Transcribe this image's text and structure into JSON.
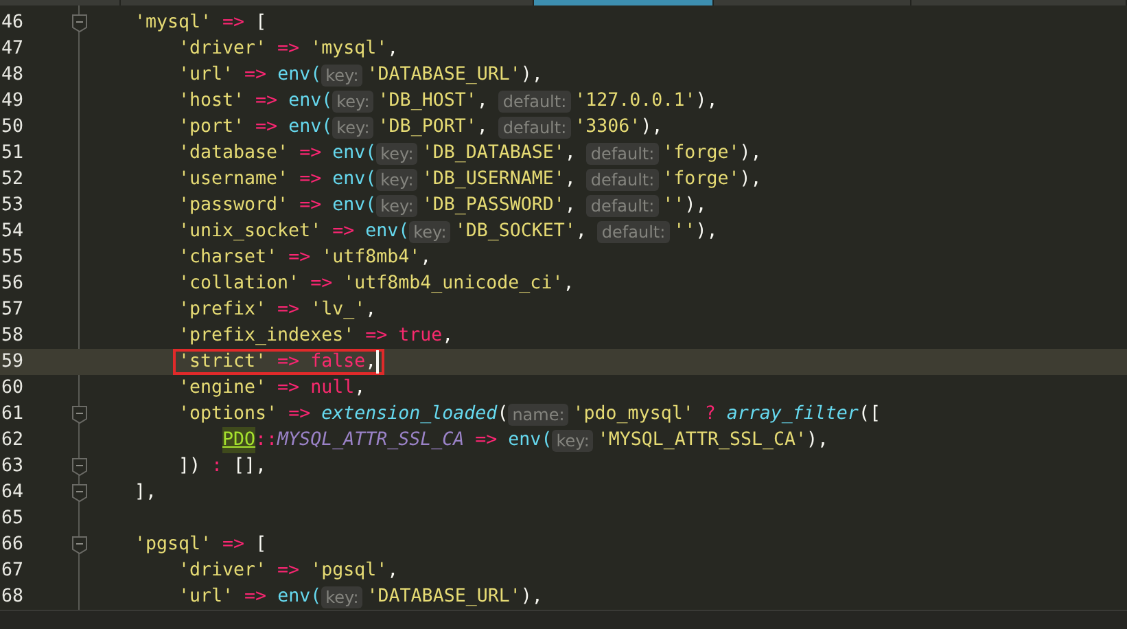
{
  "tabs": [
    {
      "selected": false
    },
    {
      "selected": false
    },
    {
      "selected": true
    },
    {
      "selected": false
    },
    {
      "selected": false
    }
  ],
  "lines": [
    {
      "number": "46",
      "fold": true,
      "current": false,
      "boxed": false,
      "caret": false,
      "tokens": [
        {
          "kind": "str",
          "text": "'mysql'"
        },
        {
          "kind": "op",
          "text": " => "
        },
        {
          "kind": "punc",
          "text": "["
        }
      ],
      "children": [
        {
          "number": "47",
          "fold": false,
          "current": false,
          "boxed": false,
          "caret": false,
          "tokens": [
            {
              "kind": "str",
              "text": "'driver'"
            },
            {
              "kind": "op",
              "text": " => "
            },
            {
              "kind": "str",
              "text": "'mysql'"
            },
            {
              "kind": "punc",
              "text": ","
            }
          ]
        },
        {
          "number": "48",
          "fold": false,
          "current": false,
          "boxed": false,
          "caret": false,
          "tokens": [
            {
              "kind": "str",
              "text": "'url'"
            },
            {
              "kind": "op",
              "text": " => "
            },
            {
              "kind": "func",
              "text": "env("
            },
            {
              "kind": "hint",
              "text": "key:"
            },
            {
              "kind": "str",
              "text": "'DATABASE_URL'"
            },
            {
              "kind": "punc",
              "text": "),"
            }
          ]
        },
        {
          "number": "49",
          "fold": false,
          "current": false,
          "boxed": false,
          "caret": false,
          "tokens": [
            {
              "kind": "str",
              "text": "'host'"
            },
            {
              "kind": "op",
              "text": " => "
            },
            {
              "kind": "func",
              "text": "env("
            },
            {
              "kind": "hint",
              "text": "key:"
            },
            {
              "kind": "str",
              "text": "'DB_HOST'"
            },
            {
              "kind": "punc",
              "text": ", "
            },
            {
              "kind": "hint",
              "text": "default:"
            },
            {
              "kind": "str",
              "text": "'127.0.0.1'"
            },
            {
              "kind": "punc",
              "text": "),"
            }
          ]
        },
        {
          "number": "50",
          "fold": false,
          "current": false,
          "boxed": false,
          "caret": false,
          "tokens": [
            {
              "kind": "str",
              "text": "'port'"
            },
            {
              "kind": "op",
              "text": " => "
            },
            {
              "kind": "func",
              "text": "env("
            },
            {
              "kind": "hint",
              "text": "key:"
            },
            {
              "kind": "str",
              "text": "'DB_PORT'"
            },
            {
              "kind": "punc",
              "text": ", "
            },
            {
              "kind": "hint",
              "text": "default:"
            },
            {
              "kind": "str",
              "text": "'3306'"
            },
            {
              "kind": "punc",
              "text": "),"
            }
          ]
        },
        {
          "number": "51",
          "fold": false,
          "current": false,
          "boxed": false,
          "caret": false,
          "tokens": [
            {
              "kind": "str",
              "text": "'database'"
            },
            {
              "kind": "op",
              "text": " => "
            },
            {
              "kind": "func",
              "text": "env("
            },
            {
              "kind": "hint",
              "text": "key:"
            },
            {
              "kind": "str",
              "text": "'DB_DATABASE'"
            },
            {
              "kind": "punc",
              "text": ", "
            },
            {
              "kind": "hint",
              "text": "default:"
            },
            {
              "kind": "str",
              "text": "'forge'"
            },
            {
              "kind": "punc",
              "text": "),"
            }
          ]
        },
        {
          "number": "52",
          "fold": false,
          "current": false,
          "boxed": false,
          "caret": false,
          "tokens": [
            {
              "kind": "str",
              "text": "'username'"
            },
            {
              "kind": "op",
              "text": " => "
            },
            {
              "kind": "func",
              "text": "env("
            },
            {
              "kind": "hint",
              "text": "key:"
            },
            {
              "kind": "str",
              "text": "'DB_USERNAME'"
            },
            {
              "kind": "punc",
              "text": ", "
            },
            {
              "kind": "hint",
              "text": "default:"
            },
            {
              "kind": "str",
              "text": "'forge'"
            },
            {
              "kind": "punc",
              "text": "),"
            }
          ]
        },
        {
          "number": "53",
          "fold": false,
          "current": false,
          "boxed": false,
          "caret": false,
          "tokens": [
            {
              "kind": "str",
              "text": "'password'"
            },
            {
              "kind": "op",
              "text": " => "
            },
            {
              "kind": "func",
              "text": "env("
            },
            {
              "kind": "hint",
              "text": "key:"
            },
            {
              "kind": "str",
              "text": "'DB_PASSWORD'"
            },
            {
              "kind": "punc",
              "text": ", "
            },
            {
              "kind": "hint",
              "text": "default:"
            },
            {
              "kind": "str",
              "text": "''"
            },
            {
              "kind": "punc",
              "text": "),"
            }
          ]
        },
        {
          "number": "54",
          "fold": false,
          "current": false,
          "boxed": false,
          "caret": false,
          "tokens": [
            {
              "kind": "str",
              "text": "'unix_socket'"
            },
            {
              "kind": "op",
              "text": " => "
            },
            {
              "kind": "func",
              "text": "env("
            },
            {
              "kind": "hint",
              "text": "key:"
            },
            {
              "kind": "str",
              "text": "'DB_SOCKET'"
            },
            {
              "kind": "punc",
              "text": ", "
            },
            {
              "kind": "hint",
              "text": "default:"
            },
            {
              "kind": "str",
              "text": "''"
            },
            {
              "kind": "punc",
              "text": "),"
            }
          ]
        },
        {
          "number": "55",
          "fold": false,
          "current": false,
          "boxed": false,
          "caret": false,
          "tokens": [
            {
              "kind": "str",
              "text": "'charset'"
            },
            {
              "kind": "op",
              "text": " => "
            },
            {
              "kind": "str",
              "text": "'utf8mb4'"
            },
            {
              "kind": "punc",
              "text": ","
            }
          ]
        },
        {
          "number": "56",
          "fold": false,
          "current": false,
          "boxed": false,
          "caret": false,
          "tokens": [
            {
              "kind": "str",
              "text": "'collation'"
            },
            {
              "kind": "op",
              "text": " => "
            },
            {
              "kind": "str",
              "text": "'utf8mb4_unicode_ci'"
            },
            {
              "kind": "punc",
              "text": ","
            }
          ]
        },
        {
          "number": "57",
          "fold": false,
          "current": false,
          "boxed": false,
          "caret": false,
          "tokens": [
            {
              "kind": "str",
              "text": "'prefix'"
            },
            {
              "kind": "op",
              "text": " => "
            },
            {
              "kind": "str",
              "text": "'lv_'"
            },
            {
              "kind": "punc",
              "text": ","
            }
          ]
        },
        {
          "number": "58",
          "fold": false,
          "current": false,
          "boxed": false,
          "caret": false,
          "tokens": [
            {
              "kind": "str",
              "text": "'prefix_indexes'"
            },
            {
              "kind": "op",
              "text": " => "
            },
            {
              "kind": "kw",
              "text": "true"
            },
            {
              "kind": "punc",
              "text": ","
            }
          ]
        },
        {
          "number": "59",
          "fold": false,
          "current": true,
          "boxed": true,
          "caret": true,
          "tokens": [
            {
              "kind": "str",
              "text": "'strict'"
            },
            {
              "kind": "op",
              "text": " => "
            },
            {
              "kind": "kw",
              "text": "false"
            },
            {
              "kind": "punc",
              "text": ","
            }
          ]
        },
        {
          "number": "60",
          "fold": false,
          "current": false,
          "boxed": false,
          "caret": false,
          "tokens": [
            {
              "kind": "str",
              "text": "'engine'"
            },
            {
              "kind": "op",
              "text": " => "
            },
            {
              "kind": "kw",
              "text": "null"
            },
            {
              "kind": "punc",
              "text": ","
            }
          ]
        },
        {
          "number": "61",
          "fold": true,
          "current": false,
          "boxed": false,
          "caret": false,
          "tokens": [
            {
              "kind": "str",
              "text": "'options'"
            },
            {
              "kind": "op",
              "text": " => "
            },
            {
              "kind": "ifunc",
              "text": "extension_loaded"
            },
            {
              "kind": "punc",
              "text": "("
            },
            {
              "kind": "hint",
              "text": "name:"
            },
            {
              "kind": "str",
              "text": "'pdo_mysql'"
            },
            {
              "kind": "op",
              "text": " ? "
            },
            {
              "kind": "ifunc",
              "text": "array_filter"
            },
            {
              "kind": "punc",
              "text": "(["
            }
          ],
          "children": [
            {
              "number": "62",
              "fold": false,
              "current": false,
              "boxed": false,
              "caret": false,
              "tokens": [
                {
                  "kind": "cls",
                  "text": "PDO"
                },
                {
                  "kind": "op",
                  "text": "::"
                },
                {
                  "kind": "const",
                  "text": "MYSQL_ATTR_SSL_CA"
                },
                {
                  "kind": "op",
                  "text": " => "
                },
                {
                  "kind": "func",
                  "text": "env("
                },
                {
                  "kind": "hint",
                  "text": "key:"
                },
                {
                  "kind": "str",
                  "text": "'MYSQL_ATTR_SSL_CA'"
                },
                {
                  "kind": "punc",
                  "text": "),"
                }
              ]
            }
          ]
        },
        {
          "number": "63",
          "fold": true,
          "current": false,
          "boxed": false,
          "caret": false,
          "tokens": [
            {
              "kind": "punc",
              "text": "])"
            },
            {
              "kind": "op",
              "text": " : "
            },
            {
              "kind": "punc",
              "text": "[],"
            }
          ]
        }
      ]
    },
    {
      "number": "64",
      "fold": true,
      "current": false,
      "boxed": false,
      "caret": false,
      "tokens": [
        {
          "kind": "punc",
          "text": "],"
        }
      ]
    },
    {
      "number": "65",
      "fold": false,
      "current": false,
      "boxed": false,
      "caret": false
    },
    {
      "number": "66",
      "fold": true,
      "current": false,
      "boxed": false,
      "caret": false,
      "tokens": [
        {
          "kind": "str",
          "text": "'pgsql'"
        },
        {
          "kind": "op",
          "text": " => "
        },
        {
          "kind": "punc",
          "text": "["
        }
      ],
      "children": [
        {
          "number": "67",
          "fold": false,
          "current": false,
          "boxed": false,
          "caret": false,
          "tokens": [
            {
              "kind": "str",
              "text": "'driver'"
            },
            {
              "kind": "op",
              "text": " => "
            },
            {
              "kind": "str",
              "text": "'pgsql'"
            },
            {
              "kind": "punc",
              "text": ","
            }
          ]
        },
        {
          "number": "68",
          "fold": false,
          "current": false,
          "boxed": false,
          "caret": false,
          "tokens": [
            {
              "kind": "str",
              "text": "'url'"
            },
            {
              "kind": "op",
              "text": " => "
            },
            {
              "kind": "func",
              "text": "env("
            },
            {
              "kind": "hint",
              "text": "key:"
            },
            {
              "kind": "str",
              "text": "'DATABASE_URL'"
            },
            {
              "kind": "punc",
              "text": "),"
            }
          ]
        }
      ]
    }
  ]
}
